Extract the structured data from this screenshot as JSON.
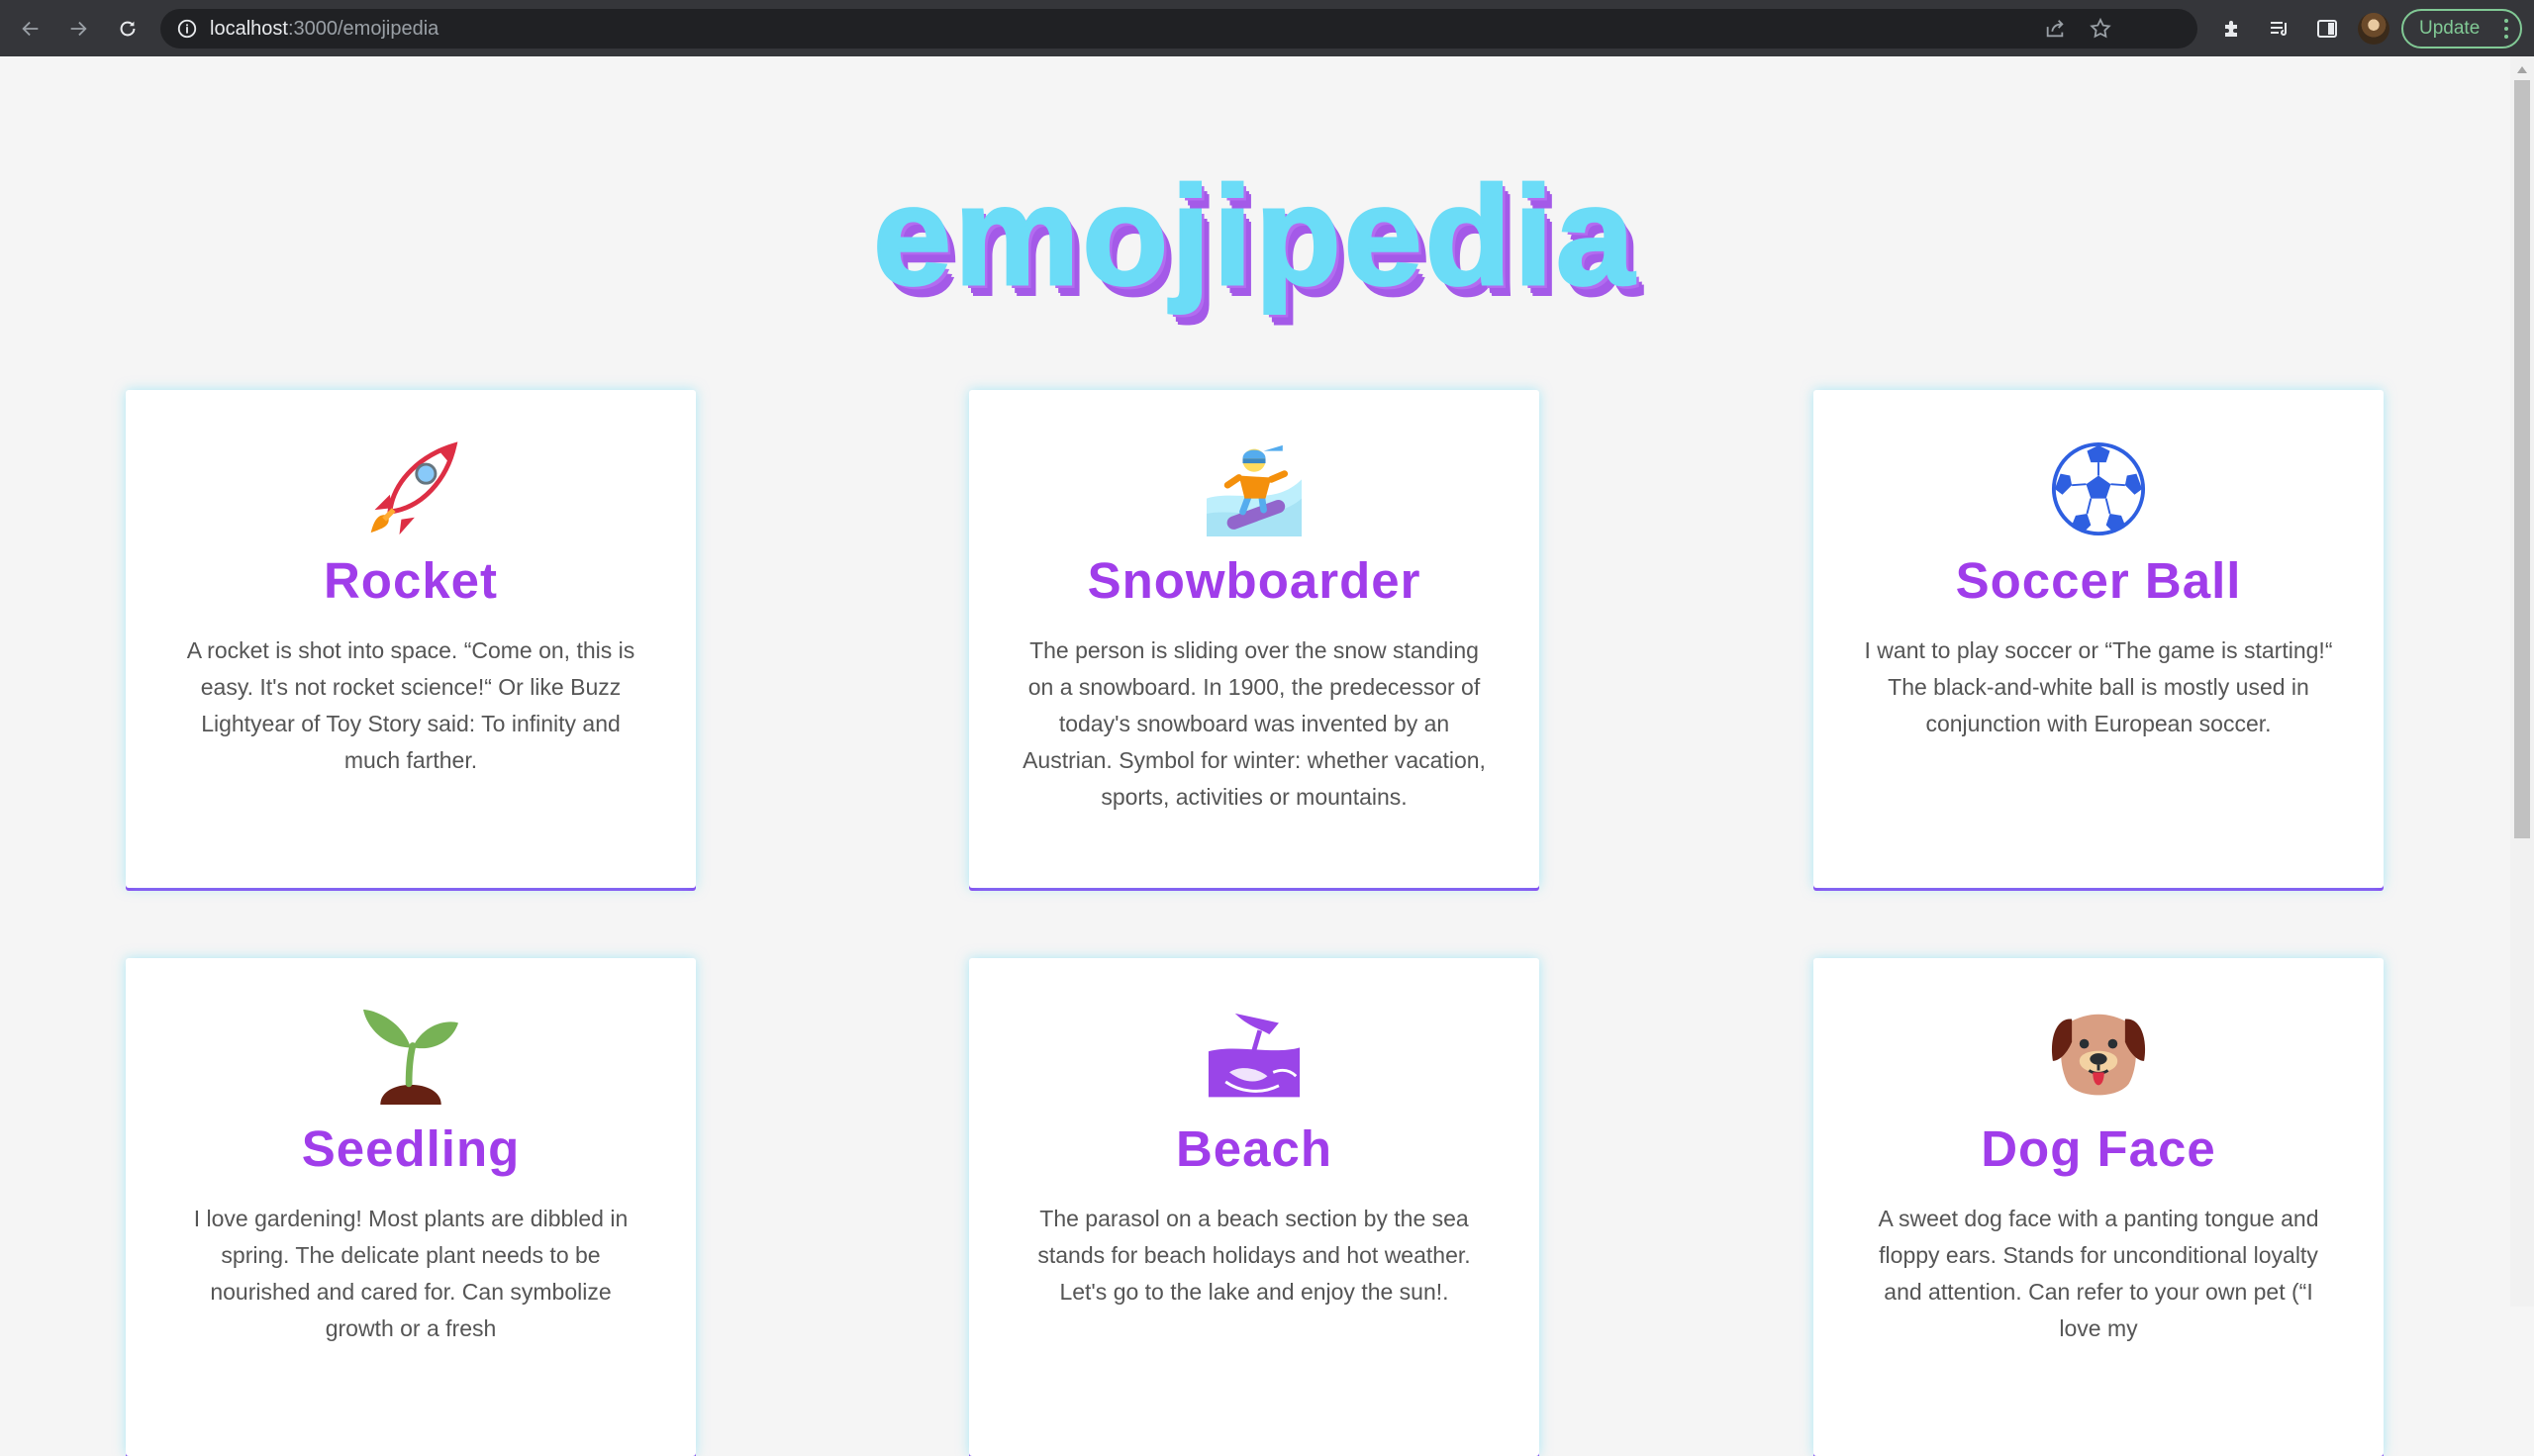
{
  "browser": {
    "url_host": "localhost",
    "url_path": ":3000/emojipedia",
    "update_label": "Update"
  },
  "page": {
    "title": "emojipedia"
  },
  "cards": [
    {
      "name": "Rocket",
      "icon": "rocket-icon",
      "description": "A rocket is shot into space. “Come on, this is easy. It's not rocket science!“ Or like Buzz Lightyear of Toy Story said: To infinity and much farther."
    },
    {
      "name": "Snowboarder",
      "icon": "snowboarder-icon",
      "description": "The person is sliding over the snow standing on a snowboard. In 1900, the predecessor of today's snowboard was invented by an Austrian. Symbol for winter: whether vacation, sports, activities or mountains."
    },
    {
      "name": "Soccer Ball",
      "icon": "soccer-ball-icon",
      "description": "I want to play soccer or “The game is starting!“ The black-and-white ball is mostly used in conjunction with European soccer."
    },
    {
      "name": "Seedling",
      "icon": "seedling-icon",
      "description": "I love gardening! Most plants are dibbled in spring. The delicate plant needs to be nourished and cared for. Can symbolize growth or a fresh"
    },
    {
      "name": "Beach",
      "icon": "beach-icon",
      "description": "The parasol on a beach section by the sea stands for beach holidays and hot weather. Let's go to the lake and enjoy the sun!."
    },
    {
      "name": "Dog Face",
      "icon": "dog-face-icon",
      "description": "A sweet dog face with a panting tongue and floppy ears. Stands for unconditional loyalty and attention. Can refer to your own pet (“I love my"
    }
  ],
  "colors": {
    "title_fill": "#6bdcf7",
    "title_shadow": "#a45ae8",
    "card_heading": "#a03dea",
    "update_green": "#81c995"
  }
}
